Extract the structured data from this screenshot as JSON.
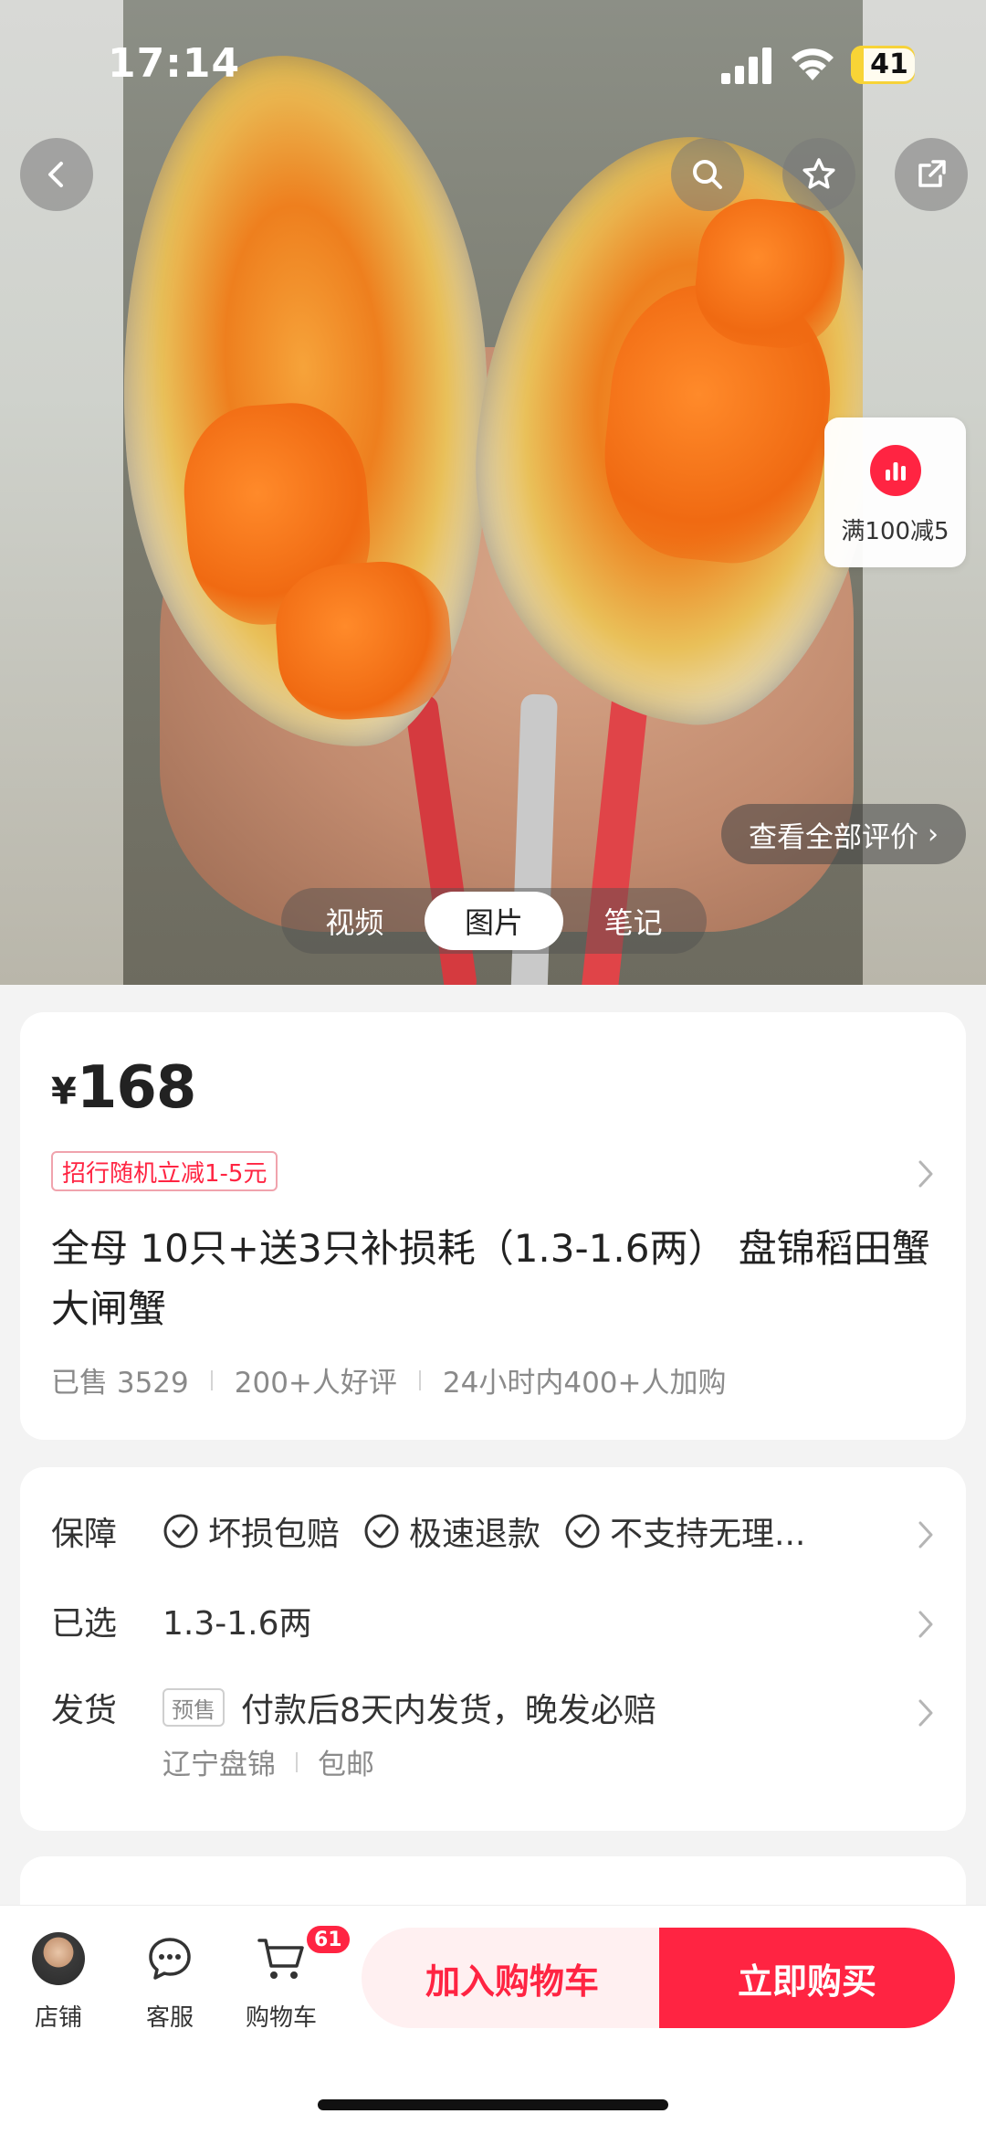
{
  "status_bar": {
    "time": "17:14",
    "battery": "41",
    "battery_level": 0.41
  },
  "hero": {
    "media_tabs": [
      {
        "label": "视频",
        "active": false
      },
      {
        "label": "图片",
        "active": true
      },
      {
        "label": "笔记",
        "active": false
      }
    ],
    "reviews_link": "查看全部评价",
    "coupon_float": "满100减5"
  },
  "icons": {
    "back": "chevron-left-icon",
    "search": "search-icon",
    "favorite": "star-icon",
    "share": "share-icon"
  },
  "product": {
    "currency": "¥",
    "price": "168",
    "promo": "招行随机立减1-5元",
    "title": "全母 10只+送3只补损耗（1.3-1.6两）  盘锦稻田蟹 大闸蟹",
    "stats": [
      "已售 3529",
      "200+人好评",
      "24小时内400+人加购"
    ]
  },
  "details": {
    "guarantee": {
      "label": "保障",
      "items": [
        "坏损包赔",
        "极速退款",
        "不支持无理..."
      ]
    },
    "selected": {
      "label": "已选",
      "value": "1.3-1.6两"
    },
    "shipping": {
      "label": "发货",
      "tag": "预售",
      "value": "付款后8天内发货，晚发必赔",
      "origin": "辽宁盘锦",
      "postage": "包邮"
    }
  },
  "bottom_bar": {
    "shop": "店铺",
    "service": "客服",
    "cart": "购物车",
    "cart_count": "61",
    "add_to_cart": "加入购物车",
    "buy_now": "立即购买"
  },
  "colors": {
    "accent": "#ff2442",
    "accent_soft": "#fff0f1",
    "background": "#f3f3f3"
  }
}
